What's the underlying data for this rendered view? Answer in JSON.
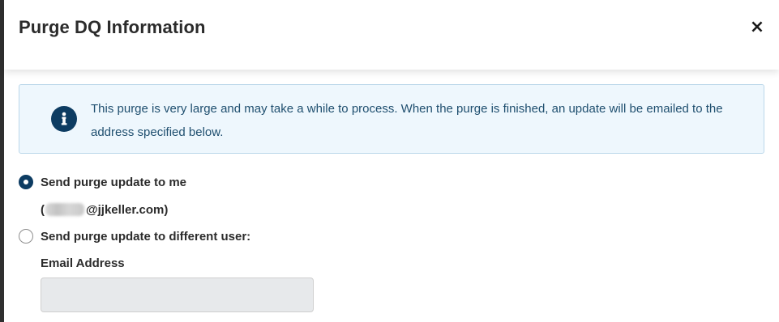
{
  "modal": {
    "title": "Purge DQ Information",
    "close_glyph": "×",
    "close_icon": "close-icon"
  },
  "alert": {
    "icon": "info-icon",
    "message": "This purge is very large and may take a while to process. When the purge is finished, an update will be emailed to the address specified below."
  },
  "options": {
    "send_to_me": {
      "label": "Send purge update to me",
      "selected": true,
      "email_prefix": "(",
      "email_suffix": "@jjkeller.com)"
    },
    "send_to_other": {
      "label": "Send purge update to different user:",
      "selected": false
    }
  },
  "email_field": {
    "label": "Email Address",
    "value": "",
    "placeholder": ""
  },
  "colors": {
    "accent": "#0d3c62",
    "alert_background": "#eef7fd",
    "alert_border": "#bcd8ea",
    "alert_text": "#1f4f6f",
    "input_background": "#e7e9eb"
  }
}
